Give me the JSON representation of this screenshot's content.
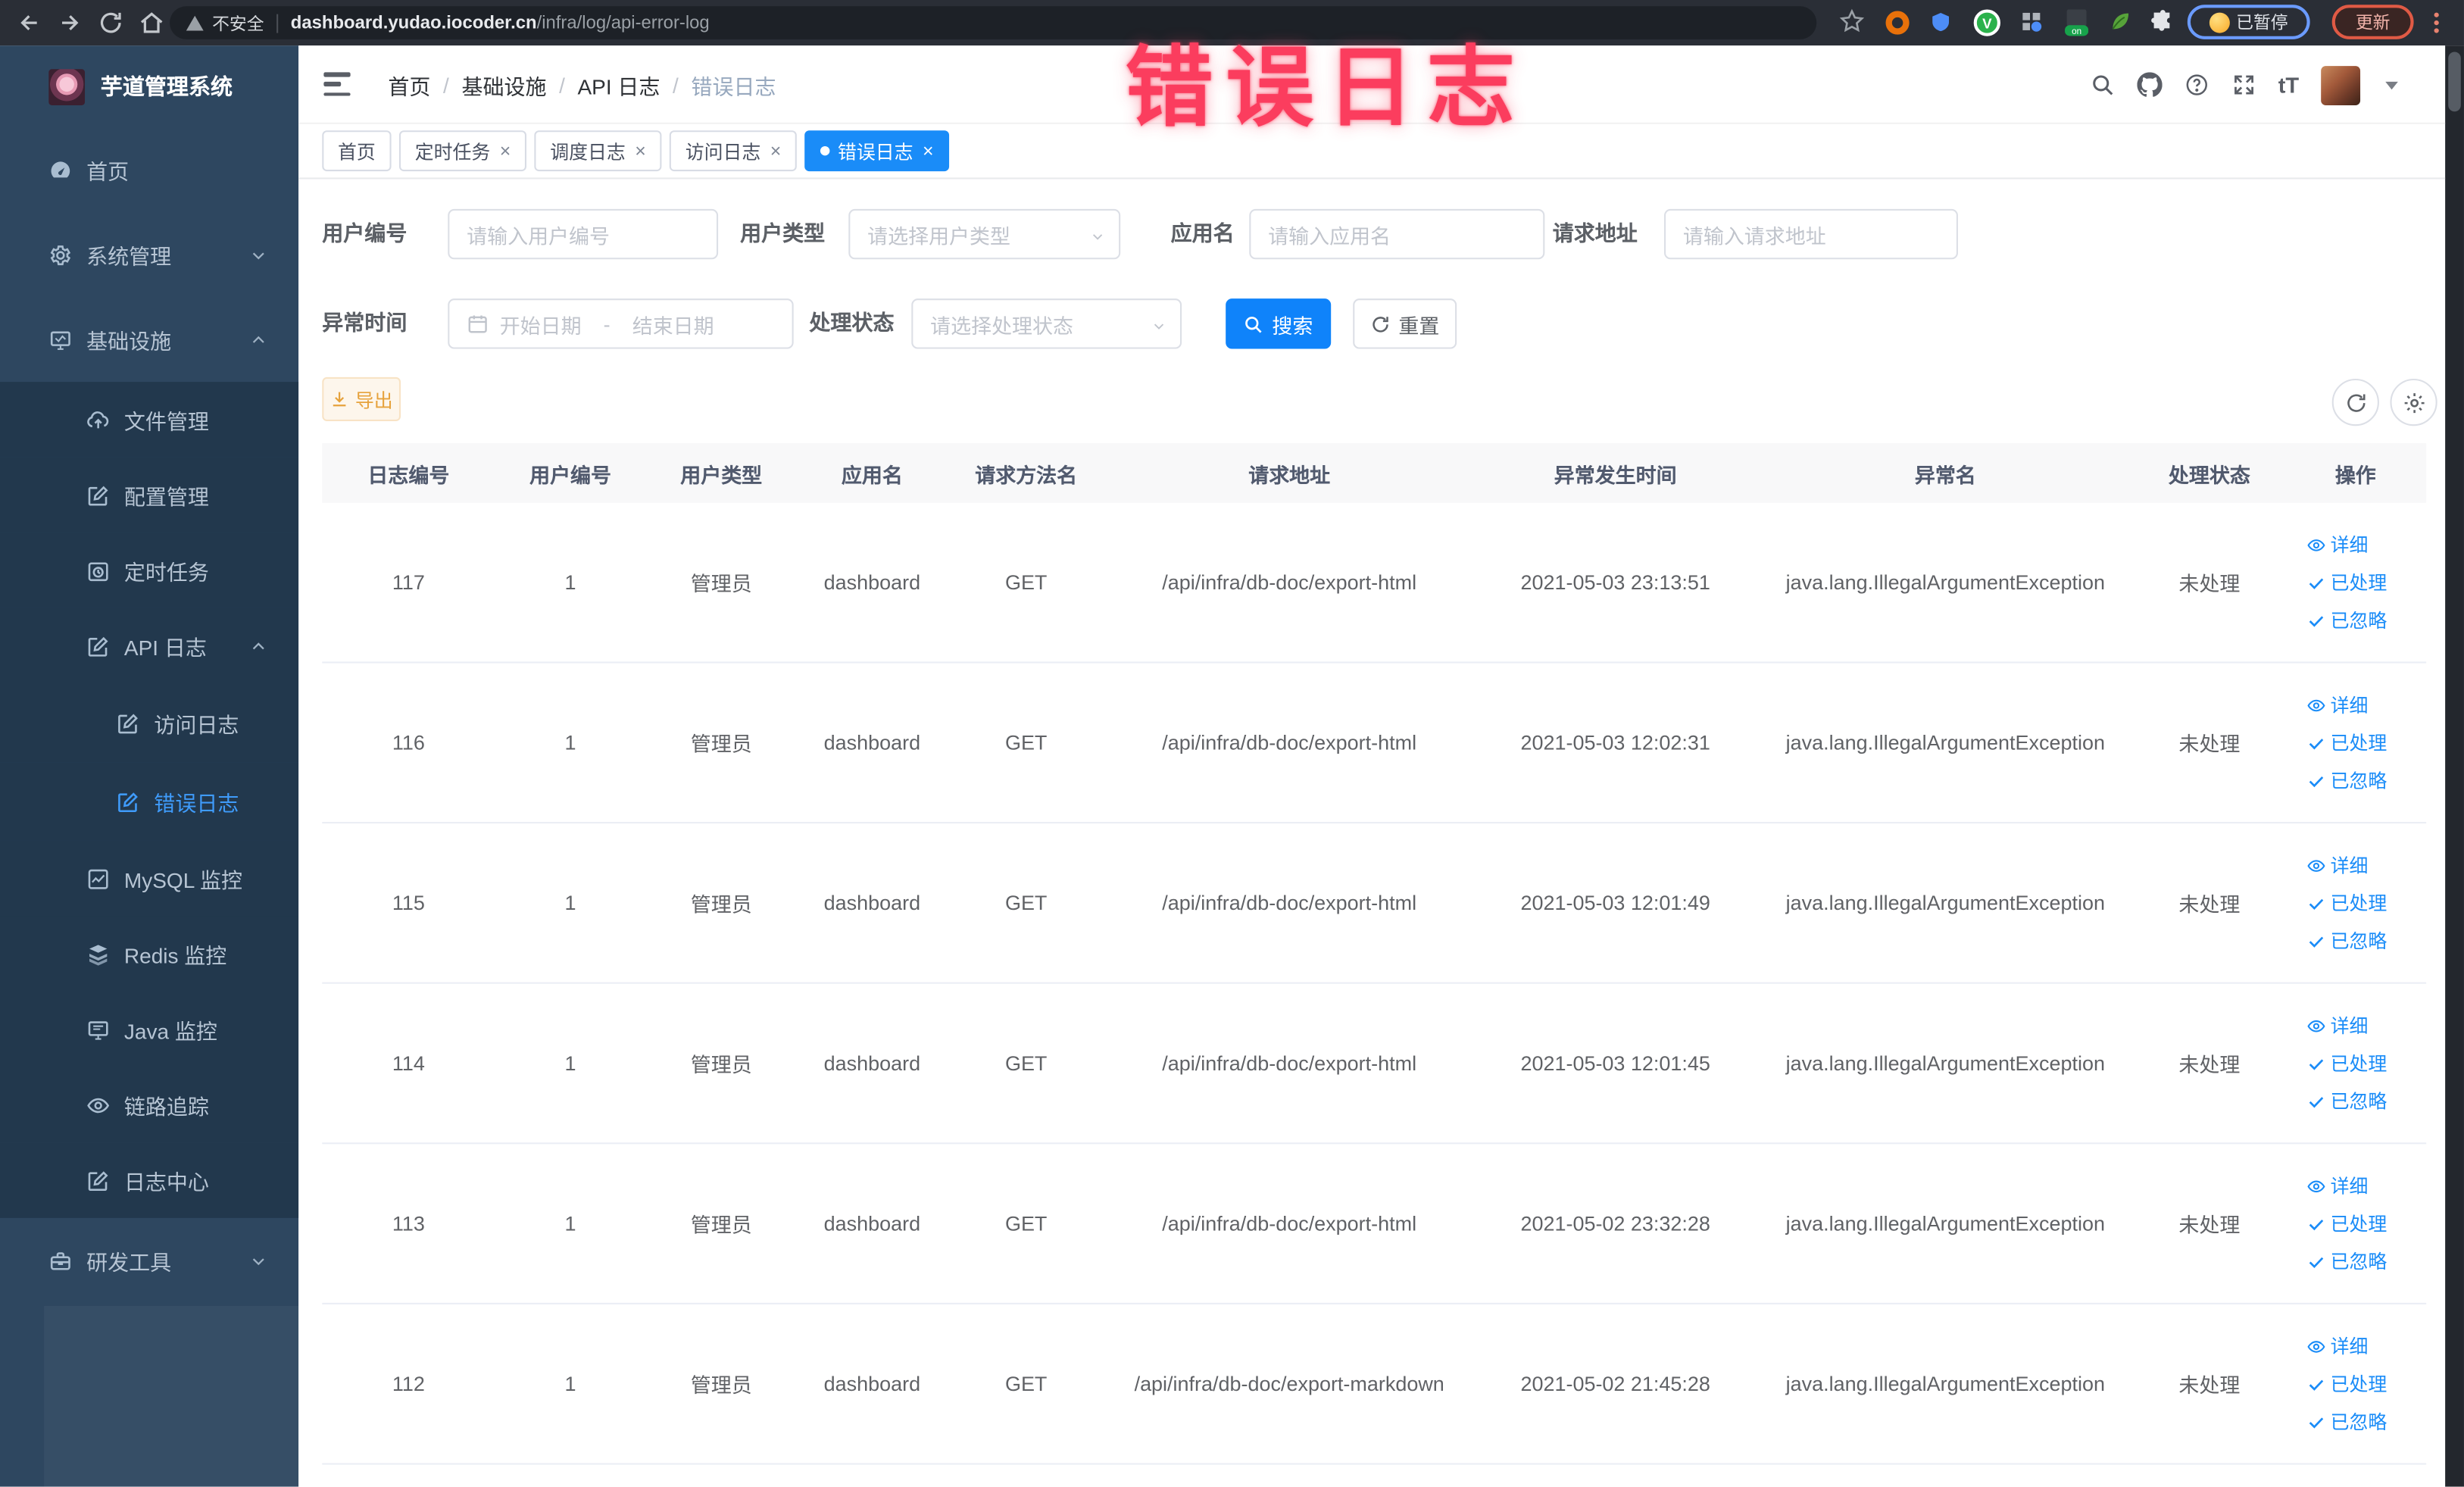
{
  "browser": {
    "security_label": "不安全",
    "url_host": "dashboard.yudao.iocoder.cn",
    "url_path": "/infra/log/api-error-log",
    "paused_badge": "已暂停",
    "update_button": "更新"
  },
  "overlay": {
    "text": "错误日志",
    "color": "#fb3d5e"
  },
  "sidebar": {
    "logo_title": "芋道管理系统",
    "items": [
      {
        "label": "首页",
        "icon": "dashboard-icon",
        "level": 1
      },
      {
        "label": "系统管理",
        "icon": "gear-icon",
        "level": 1,
        "chevron": "down"
      },
      {
        "label": "基础设施",
        "icon": "monitor-icon",
        "level": 1,
        "chevron": "up"
      },
      {
        "label": "文件管理",
        "icon": "upload-icon",
        "level": 2,
        "sub": true
      },
      {
        "label": "配置管理",
        "icon": "edit-icon",
        "level": 2,
        "sub": true
      },
      {
        "label": "定时任务",
        "icon": "job-icon",
        "level": 2,
        "sub": true
      },
      {
        "label": "API 日志",
        "icon": "log-icon",
        "level": 2,
        "sub": true,
        "chevron": "up"
      },
      {
        "label": "访问日志",
        "icon": "log-icon",
        "level": 3,
        "sub": true
      },
      {
        "label": "错误日志",
        "icon": "log-icon",
        "level": 3,
        "sub": true,
        "active": true
      },
      {
        "label": "MySQL 监控",
        "icon": "mysql-icon",
        "level": 2,
        "sub": true
      },
      {
        "label": "Redis 监控",
        "icon": "redis-icon",
        "level": 2,
        "sub": true
      },
      {
        "label": "Java 监控",
        "icon": "java-icon",
        "level": 2,
        "sub": true
      },
      {
        "label": "链路追踪",
        "icon": "trace-icon",
        "level": 2,
        "sub": true
      },
      {
        "label": "日志中心",
        "icon": "logcenter-icon",
        "level": 2,
        "sub": true
      },
      {
        "label": "研发工具",
        "icon": "tools-icon",
        "level": 1,
        "chevron": "down"
      }
    ]
  },
  "header": {
    "breadcrumb": [
      "首页",
      "基础设施",
      "API 日志",
      "错误日志"
    ]
  },
  "tags": [
    {
      "label": "首页"
    },
    {
      "label": "定时任务",
      "closable": true
    },
    {
      "label": "调度日志",
      "closable": true
    },
    {
      "label": "访问日志",
      "closable": true
    },
    {
      "label": "错误日志",
      "closable": true,
      "active": true
    }
  ],
  "filters": {
    "user_id": {
      "label": "用户编号",
      "placeholder": "请输入用户编号"
    },
    "user_type": {
      "label": "用户类型",
      "placeholder": "请选择用户类型"
    },
    "app_name": {
      "label": "应用名",
      "placeholder": "请输入应用名"
    },
    "request_url": {
      "label": "请求地址",
      "placeholder": "请输入请求地址"
    },
    "exception_time": {
      "label": "异常时间",
      "start_placeholder": "开始日期",
      "separator": "-",
      "end_placeholder": "结束日期"
    },
    "process_status": {
      "label": "处理状态",
      "placeholder": "请选择处理状态"
    },
    "search_button": "搜索",
    "reset_button": "重置"
  },
  "toolbar": {
    "export_button": "导出"
  },
  "table": {
    "columns": [
      "日志编号",
      "用户编号",
      "用户类型",
      "应用名",
      "请求方法名",
      "请求地址",
      "异常发生时间",
      "异常名",
      "处理状态",
      "操作"
    ],
    "actions": [
      "详细",
      "已处理",
      "已忽略"
    ],
    "rows": [
      {
        "id": "117",
        "user_id": "1",
        "user_type": "管理员",
        "app": "dashboard",
        "method": "GET",
        "url": "/api/infra/db-doc/export-html",
        "time": "2021-05-03 23:13:51",
        "exception": "java.lang.IllegalArgumentException",
        "status": "未处理"
      },
      {
        "id": "116",
        "user_id": "1",
        "user_type": "管理员",
        "app": "dashboard",
        "method": "GET",
        "url": "/api/infra/db-doc/export-html",
        "time": "2021-05-03 12:02:31",
        "exception": "java.lang.IllegalArgumentException",
        "status": "未处理"
      },
      {
        "id": "115",
        "user_id": "1",
        "user_type": "管理员",
        "app": "dashboard",
        "method": "GET",
        "url": "/api/infra/db-doc/export-html",
        "time": "2021-05-03 12:01:49",
        "exception": "java.lang.IllegalArgumentException",
        "status": "未处理"
      },
      {
        "id": "114",
        "user_id": "1",
        "user_type": "管理员",
        "app": "dashboard",
        "method": "GET",
        "url": "/api/infra/db-doc/export-html",
        "time": "2021-05-03 12:01:45",
        "exception": "java.lang.IllegalArgumentException",
        "status": "未处理"
      },
      {
        "id": "113",
        "user_id": "1",
        "user_type": "管理员",
        "app": "dashboard",
        "method": "GET",
        "url": "/api/infra/db-doc/export-html",
        "time": "2021-05-02 23:32:28",
        "exception": "java.lang.IllegalArgumentException",
        "status": "未处理"
      },
      {
        "id": "112",
        "user_id": "1",
        "user_type": "管理员",
        "app": "dashboard",
        "method": "GET",
        "url": "/api/infra/db-doc/export-markdown",
        "time": "2021-05-02 21:45:28",
        "exception": "java.lang.IllegalArgumentException",
        "status": "未处理"
      }
    ]
  },
  "colors": {
    "primary": "#0f83fa",
    "active_tag": "#1a8cf8",
    "warning": "#e6a23c",
    "sidebar_bg": "#2e4760",
    "submenu_bg": "#22384d"
  }
}
